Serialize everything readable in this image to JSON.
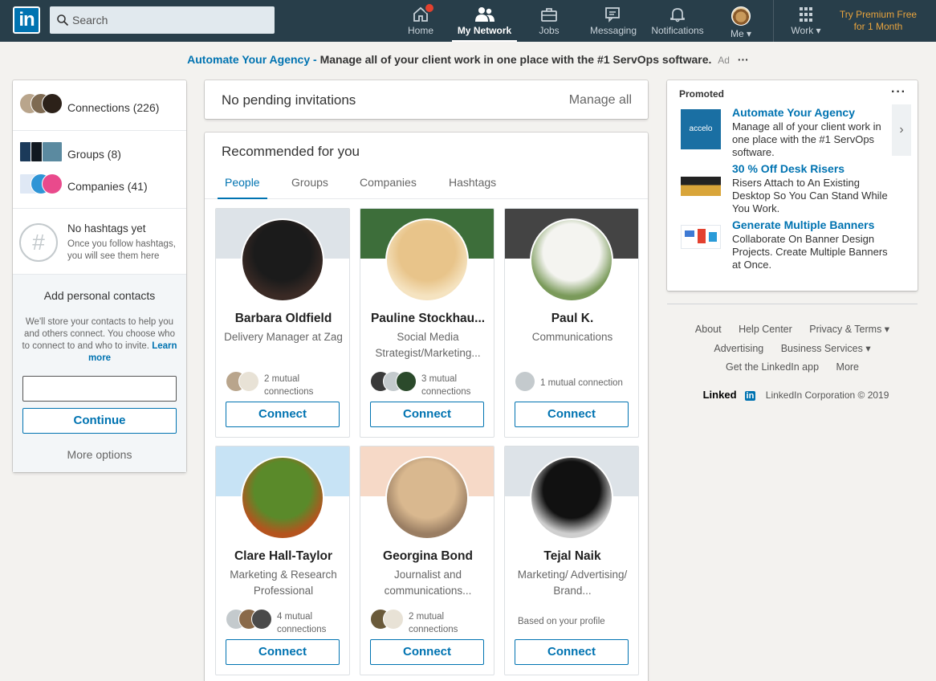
{
  "nav": {
    "logo": "in",
    "search_placeholder": "Search",
    "items": [
      {
        "label": "Home",
        "icon": "home-icon"
      },
      {
        "label": "My Network",
        "icon": "people-icon"
      },
      {
        "label": "Jobs",
        "icon": "briefcase-icon"
      },
      {
        "label": "Messaging",
        "icon": "chat-icon"
      },
      {
        "label": "Notifications",
        "icon": "bell-icon"
      },
      {
        "label": "Me ▾",
        "icon": "avatar"
      },
      {
        "label": "Work ▾",
        "icon": "grid-icon"
      }
    ],
    "premium_line1": "Try Premium Free",
    "premium_line2": "for 1 Month"
  },
  "ad": {
    "title": "Automate Your Agency -",
    "text": "Manage all of your client work in one place with the #1 ServOps software.",
    "tag": "Ad",
    "more": "···"
  },
  "left": {
    "connections": "Connections (226)",
    "groups": "Groups (8)",
    "companies": "Companies (41)",
    "hashtags_title": "No hashtags yet",
    "hashtags_desc1": "Once you follow hashtags,",
    "hashtags_desc2": "you will see them here",
    "add_title": "Add personal contacts",
    "add_desc": "We'll store your contacts to help you and others connect. You choose who to connect to and who to invite.",
    "learn_more": "Learn more",
    "continue": "Continue",
    "more_options": "More options"
  },
  "pending": {
    "text": "No pending invitations",
    "manage": "Manage all"
  },
  "recs": {
    "title": "Recommended for you",
    "tabs": [
      "People",
      "Groups",
      "Companies",
      "Hashtags"
    ],
    "connect": "Connect",
    "people": [
      {
        "name": "Barbara Oldfield",
        "occ": "Delivery Manager at Zag",
        "mutual": "2 mutual connections",
        "bg": "#dde3e8",
        "av": "#1b1b1b",
        "av2": "#3a2a25"
      },
      {
        "name": "Pauline Stockhau...",
        "occ": "Social Media Strategist/Marketing...",
        "mutual": "3 mutual connections",
        "bg": "#3d6e3a",
        "av": "#e8c48a",
        "av2": "#f5e3c0"
      },
      {
        "name": "Paul K.",
        "occ": "Communications",
        "mutual": "1 mutual connection",
        "bg": "#444444",
        "av": "#f4f4f0",
        "av2": "#7a9a5a"
      },
      {
        "name": "Clare Hall-Taylor",
        "occ": "Marketing & Research Professional",
        "mutual": "4 mutual connections",
        "bg": "#c7e3f5",
        "av": "#5a8a2a",
        "av2": "#b4541e"
      },
      {
        "name": "Georgina Bond",
        "occ": "Journalist and communications...",
        "mutual": "2 mutual connections",
        "bg": "#f6d9c7",
        "av": "#d9b88f",
        "av2": "#9a7e63"
      },
      {
        "name": "Tejal Naik",
        "occ": "Marketing/ Advertising/ Brand...",
        "mutual": "Based on your profile",
        "bg": "#dde3e8",
        "av": "#111111",
        "av2": "#cfcfcf"
      }
    ]
  },
  "promo": {
    "header": "Promoted",
    "more": "···",
    "arrow": "›",
    "items": [
      {
        "title": "Automate Your Agency",
        "desc": "Manage all of your client work in one place with the #1 ServOps software.",
        "logo": "accelo"
      },
      {
        "title": "30 % Off Desk Risers",
        "desc": "Risers Attach to An Existing Desktop So You Can Stand While You Work."
      },
      {
        "title": "Generate Multiple Banners",
        "desc": "Collaborate On Banner Design Projects. Create Multiple Banners at Once."
      }
    ]
  },
  "footer": {
    "row1": [
      "About",
      "Help Center",
      "Privacy & Terms ▾"
    ],
    "row2": [
      "Advertising",
      "Business Services ▾"
    ],
    "row3": [
      "Get the LinkedIn app",
      "More"
    ],
    "brand": "Linked",
    "brand_in": "in",
    "corp": "LinkedIn Corporation © 2019"
  }
}
